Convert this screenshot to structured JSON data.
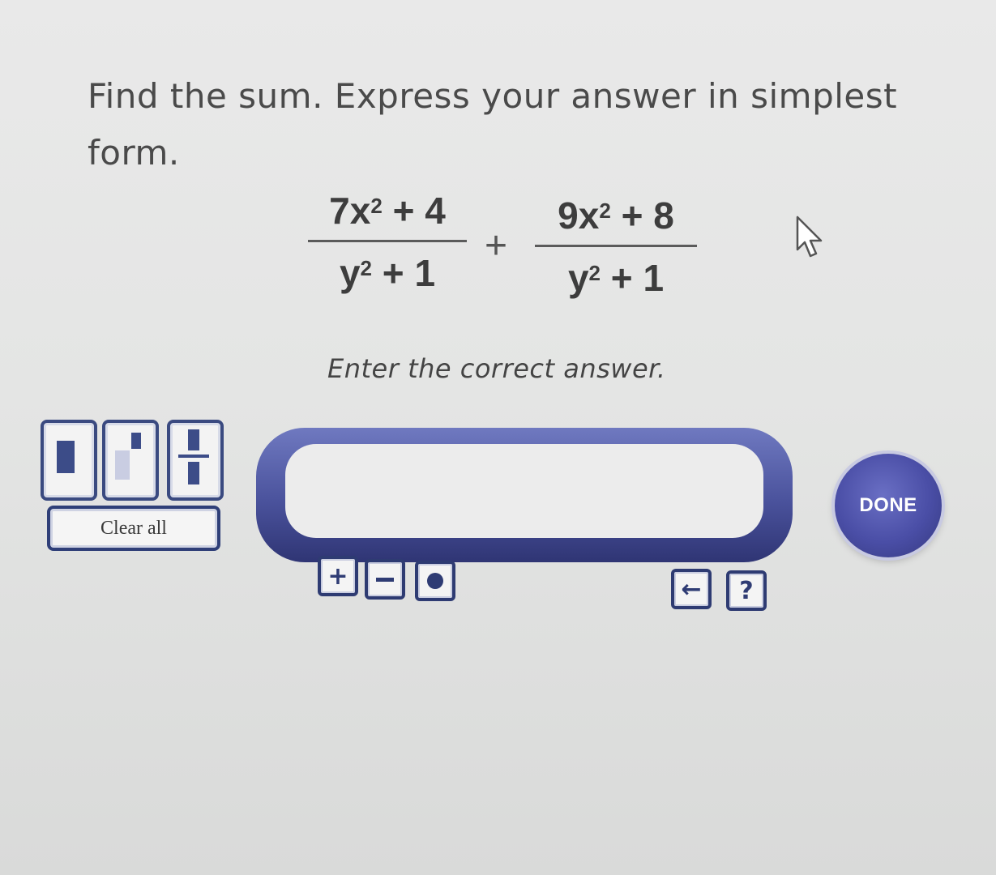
{
  "question": {
    "prompt": "Find the sum. Express your answer in simplest form.",
    "instruction": "Enter the correct answer."
  },
  "expression": {
    "fraction1": {
      "num_coef": "7x",
      "num_exp": "2",
      "num_rest": " + 4",
      "den_base": "y",
      "den_exp": "2",
      "den_rest": " + 1"
    },
    "operator": "+",
    "fraction2": {
      "num_coef": "9x",
      "num_exp": "2",
      "num_rest": " + 8",
      "den_base": "y",
      "den_exp": "2",
      "den_rest": " + 1"
    }
  },
  "keypad": {
    "template_buttons": [
      "box-icon",
      "exponent-icon",
      "fraction-icon"
    ],
    "clear_label": "Clear all",
    "plus_label": "+",
    "back_icon": "←",
    "help_label": "?"
  },
  "answer": {
    "value": "",
    "placeholder": ""
  },
  "done_label": "DONE",
  "colors": {
    "accent": "#3c4c88",
    "done": "#4a4ea6"
  }
}
